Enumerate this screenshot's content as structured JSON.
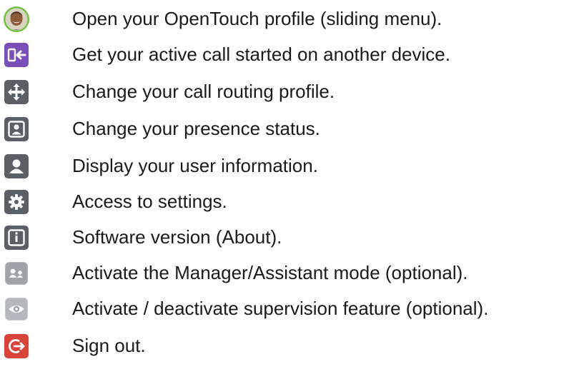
{
  "items": [
    {
      "icon": "profile-avatar-icon",
      "label": "Open your OpenTouch profile (sliding menu)."
    },
    {
      "icon": "device-transfer-icon",
      "label": "Get your active call started on another device."
    },
    {
      "icon": "call-routing-icon",
      "label": "Change your call routing profile."
    },
    {
      "icon": "presence-status-icon",
      "label": "Change your presence status."
    },
    {
      "icon": "user-info-icon",
      "label": "Display your user information."
    },
    {
      "icon": "gear-icon",
      "label": "Access to settings."
    },
    {
      "icon": "info-icon",
      "label": "Software version (About)."
    },
    {
      "icon": "manager-assistant-icon",
      "label": "Activate the Manager/Assistant mode (optional)."
    },
    {
      "icon": "eye-icon",
      "label": "Activate / deactivate supervision feature (optional)."
    },
    {
      "icon": "sign-out-icon",
      "label": "Sign out."
    }
  ],
  "colors": {
    "text": "#1a1a1a",
    "avatar_ring": "#6fbf3f",
    "purple": "#7b4fb8",
    "gray_dark": "#5a5f66",
    "gray_light": "#b4b8bd",
    "red": "#d9443a"
  }
}
